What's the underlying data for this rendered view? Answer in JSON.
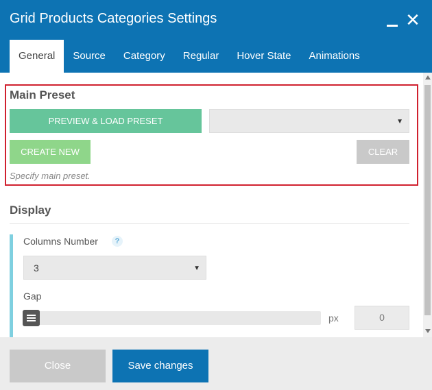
{
  "window": {
    "title": "Grid Products Categories Settings",
    "minimize_icon": "minimize-icon",
    "close_icon": "close-icon"
  },
  "tabs": [
    {
      "label": "General",
      "active": true
    },
    {
      "label": "Source",
      "active": false
    },
    {
      "label": "Category",
      "active": false
    },
    {
      "label": "Regular",
      "active": false
    },
    {
      "label": "Hover State",
      "active": false
    },
    {
      "label": "Animations",
      "active": false
    }
  ],
  "preset": {
    "title": "Main Preset",
    "preview_label": "PREVIEW & LOAD PRESET",
    "select_value": "",
    "create_label": "CREATE NEW",
    "clear_label": "CLEAR",
    "hint": "Specify main preset."
  },
  "display": {
    "title": "Display",
    "columns_label": "Columns Number",
    "columns_help": "?",
    "columns_value": "3",
    "gap_label": "Gap",
    "gap_unit": "px",
    "gap_value": "0"
  },
  "footer": {
    "close_label": "Close",
    "save_label": "Save changes"
  },
  "colors": {
    "header": "#0d73b3",
    "preview_button": "#66c59b",
    "create_button": "#8fd68a",
    "highlight_border": "#d0202e",
    "accent": "#7fd0e0"
  }
}
